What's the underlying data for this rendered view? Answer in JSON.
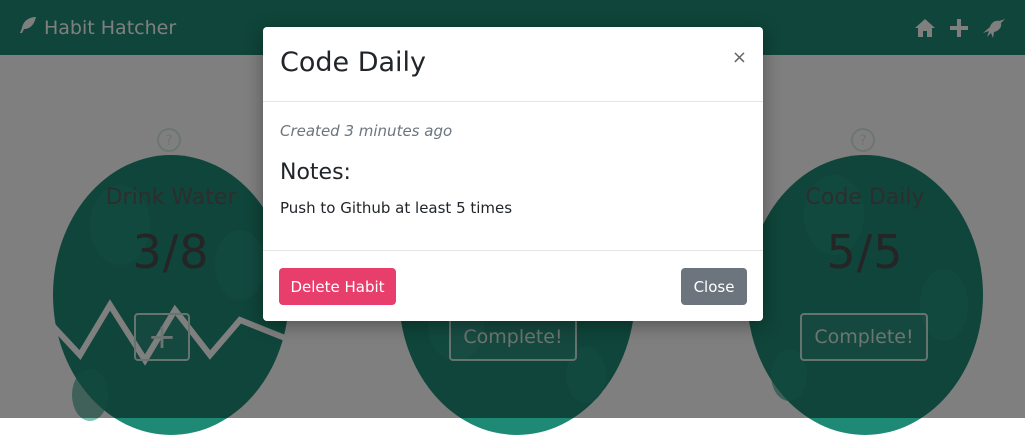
{
  "navbar": {
    "brand_label": "Habit Hatcher",
    "icons": [
      "feather-icon",
      "home-icon",
      "plus-icon",
      "crow-icon"
    ]
  },
  "eggs": [
    {
      "title": "Drink Water",
      "count": "3/8",
      "button": "+",
      "cracked": true
    },
    {
      "title": "",
      "count": "",
      "button": "Complete!",
      "cracked": false
    },
    {
      "title": "Code Daily",
      "count": "5/5",
      "button": "Complete!",
      "cracked": false
    }
  ],
  "modal": {
    "title": "Code Daily",
    "close_symbol": "×",
    "created": "Created 3 minutes ago",
    "notes_heading": "Notes:",
    "notes_text": "Push to Github at least 5 times",
    "delete_label": "Delete Habit",
    "close_label": "Close"
  },
  "colors": {
    "navbar": "#1e8a75",
    "egg": "#1e8a75",
    "delete_button": "#e83e6c",
    "close_button": "#6c757d"
  }
}
